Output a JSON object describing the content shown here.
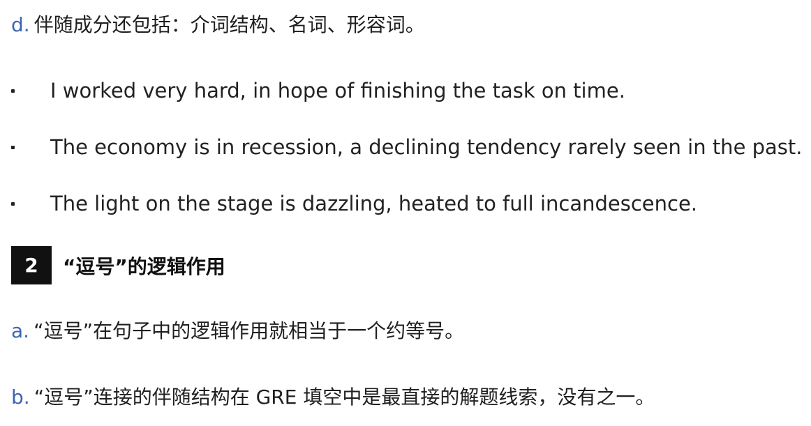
{
  "item_d": {
    "marker": "d.",
    "text": "伴随成分还包括：介词结构、名词、形容词。"
  },
  "examples": [
    "I worked very hard, in hope of finishing the task on time.",
    "The economy is in recession, a declining tendency rarely seen in the past.",
    "The light on the stage is dazzling, heated to full incandescence."
  ],
  "section": {
    "number": "2",
    "title": "“逗号”的逻辑作用"
  },
  "item_a": {
    "marker": "a.",
    "text": "“逗号”在句子中的逻辑作用就相当于一个约等号。"
  },
  "item_b": {
    "marker": "b.",
    "text": "“逗号”连接的伴随结构在 GRE 填空中是最直接的解题线索，没有之一。"
  }
}
